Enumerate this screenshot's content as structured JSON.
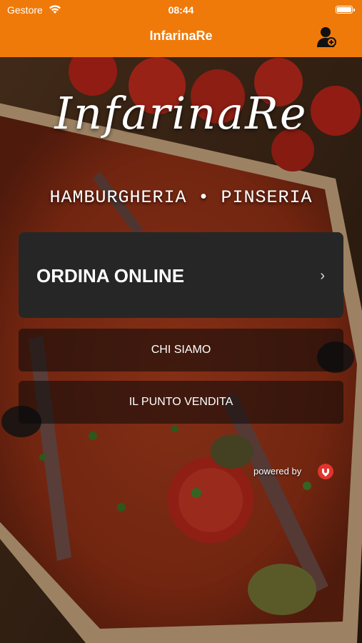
{
  "status": {
    "carrier": "Gestore",
    "time": "08:44"
  },
  "nav": {
    "title": "InfarinaRe"
  },
  "logo": {
    "name": "InfarinaRe",
    "subtitle": "HAMBURGHERIA • PINSERIA"
  },
  "menu": {
    "order_label": "ORDINA ONLINE",
    "order_chevron": "›",
    "about_label": "CHI SIAMO",
    "store_label": "IL PUNTO VENDITA"
  },
  "footer": {
    "powered": "powered by"
  },
  "colors": {
    "brand_orange": "#ef7a0a",
    "primary_button": "#262626",
    "powered_logo": "#e2342d"
  },
  "icons": [
    "wifi-icon",
    "battery-icon",
    "user-icon",
    "chevron-right-icon",
    "powered-by-logo-icon"
  ]
}
